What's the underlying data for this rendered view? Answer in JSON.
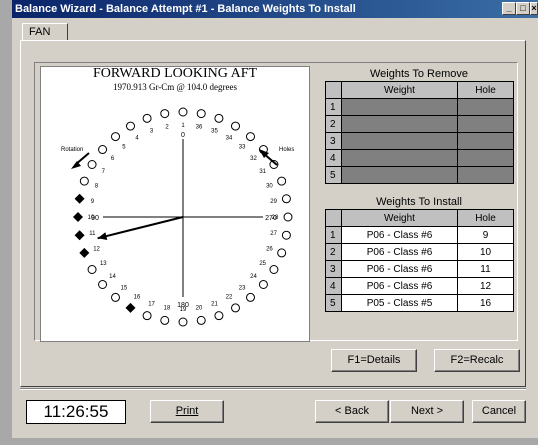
{
  "window": {
    "title": "Balance Wizard - Balance Attempt #1 - Balance Weights To Install",
    "title_buttons": [
      "_",
      "□",
      "×"
    ]
  },
  "tab": {
    "label": "FAN"
  },
  "dial": {
    "title": "FORWARD LOOKING AFT",
    "subtitle": "1970.913 Gr-Cm @ 104.0 degrees",
    "rotation_label": "Rotation",
    "holes_label": "Holes",
    "axis_labels": {
      "top": "0",
      "left": "90",
      "bottom": "180",
      "right": "270"
    },
    "hole_count": 36,
    "filled_holes": [
      9,
      10,
      11,
      12,
      16
    ],
    "vector_angle_deg": 104.0
  },
  "weights_to_remove": {
    "title": "Weights To Remove",
    "columns": [
      "Weight",
      "Hole"
    ],
    "rows": [
      "1",
      "2",
      "3",
      "4",
      "5"
    ]
  },
  "weights_to_install": {
    "title": "Weights To Install",
    "columns": [
      "Weight",
      "Hole"
    ],
    "rows": [
      {
        "n": "1",
        "weight": "P06  - Class #6",
        "hole": "9"
      },
      {
        "n": "2",
        "weight": "P06  - Class #6",
        "hole": "10"
      },
      {
        "n": "3",
        "weight": "P06  - Class #6",
        "hole": "11"
      },
      {
        "n": "4",
        "weight": "P06  - Class #6",
        "hole": "12"
      },
      {
        "n": "5",
        "weight": "P05  - Class #5",
        "hole": "16"
      }
    ]
  },
  "buttons": {
    "details": "F1=Details",
    "recalc": "F2=Recalc",
    "print": "Print",
    "back": "< Back",
    "next": "Next >",
    "cancel": "Cancel"
  },
  "clock": "11:26:55"
}
